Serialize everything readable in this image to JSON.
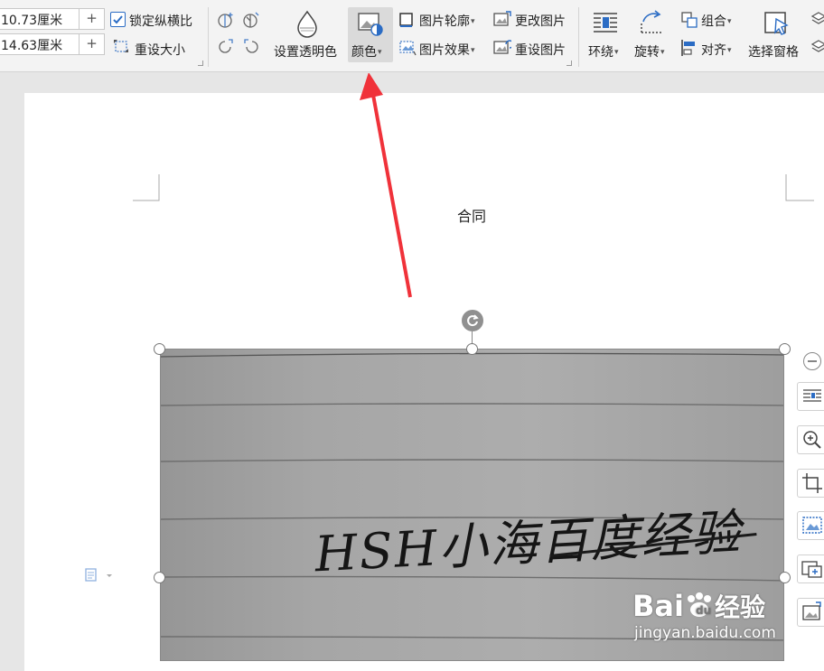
{
  "ribbon": {
    "width_value": "10.73厘米",
    "height_value": "14.63厘米",
    "plus": "+",
    "lock_ratio_label": "锁定纵横比",
    "lock_ratio_checked": true,
    "reset_size_label": "重设大小",
    "set_transparent_label": "设置透明色",
    "color_label": "颜色",
    "picture_outline_label": "图片轮廓",
    "picture_effect_label": "图片效果",
    "change_picture_label": "更改图片",
    "reset_picture_label": "重设图片",
    "wrap_label": "环绕",
    "rotate_label": "旋转",
    "group_label": "组合",
    "align_label": "对齐",
    "selection_pane_label": "选择窗格",
    "caret": "▾"
  },
  "document": {
    "title": "合同"
  },
  "photo": {
    "handwriting": "HSH小海百度经验"
  },
  "watermark": {
    "brand_left": "Bai",
    "brand_right": "经验",
    "url": "jingyan.baidu.com"
  },
  "colors": {
    "accent_check": "#2b6cc4",
    "arrow_red": "#f0323a",
    "ribbon_bg": "#f3f3f3",
    "page_bg": "#ffffff"
  }
}
